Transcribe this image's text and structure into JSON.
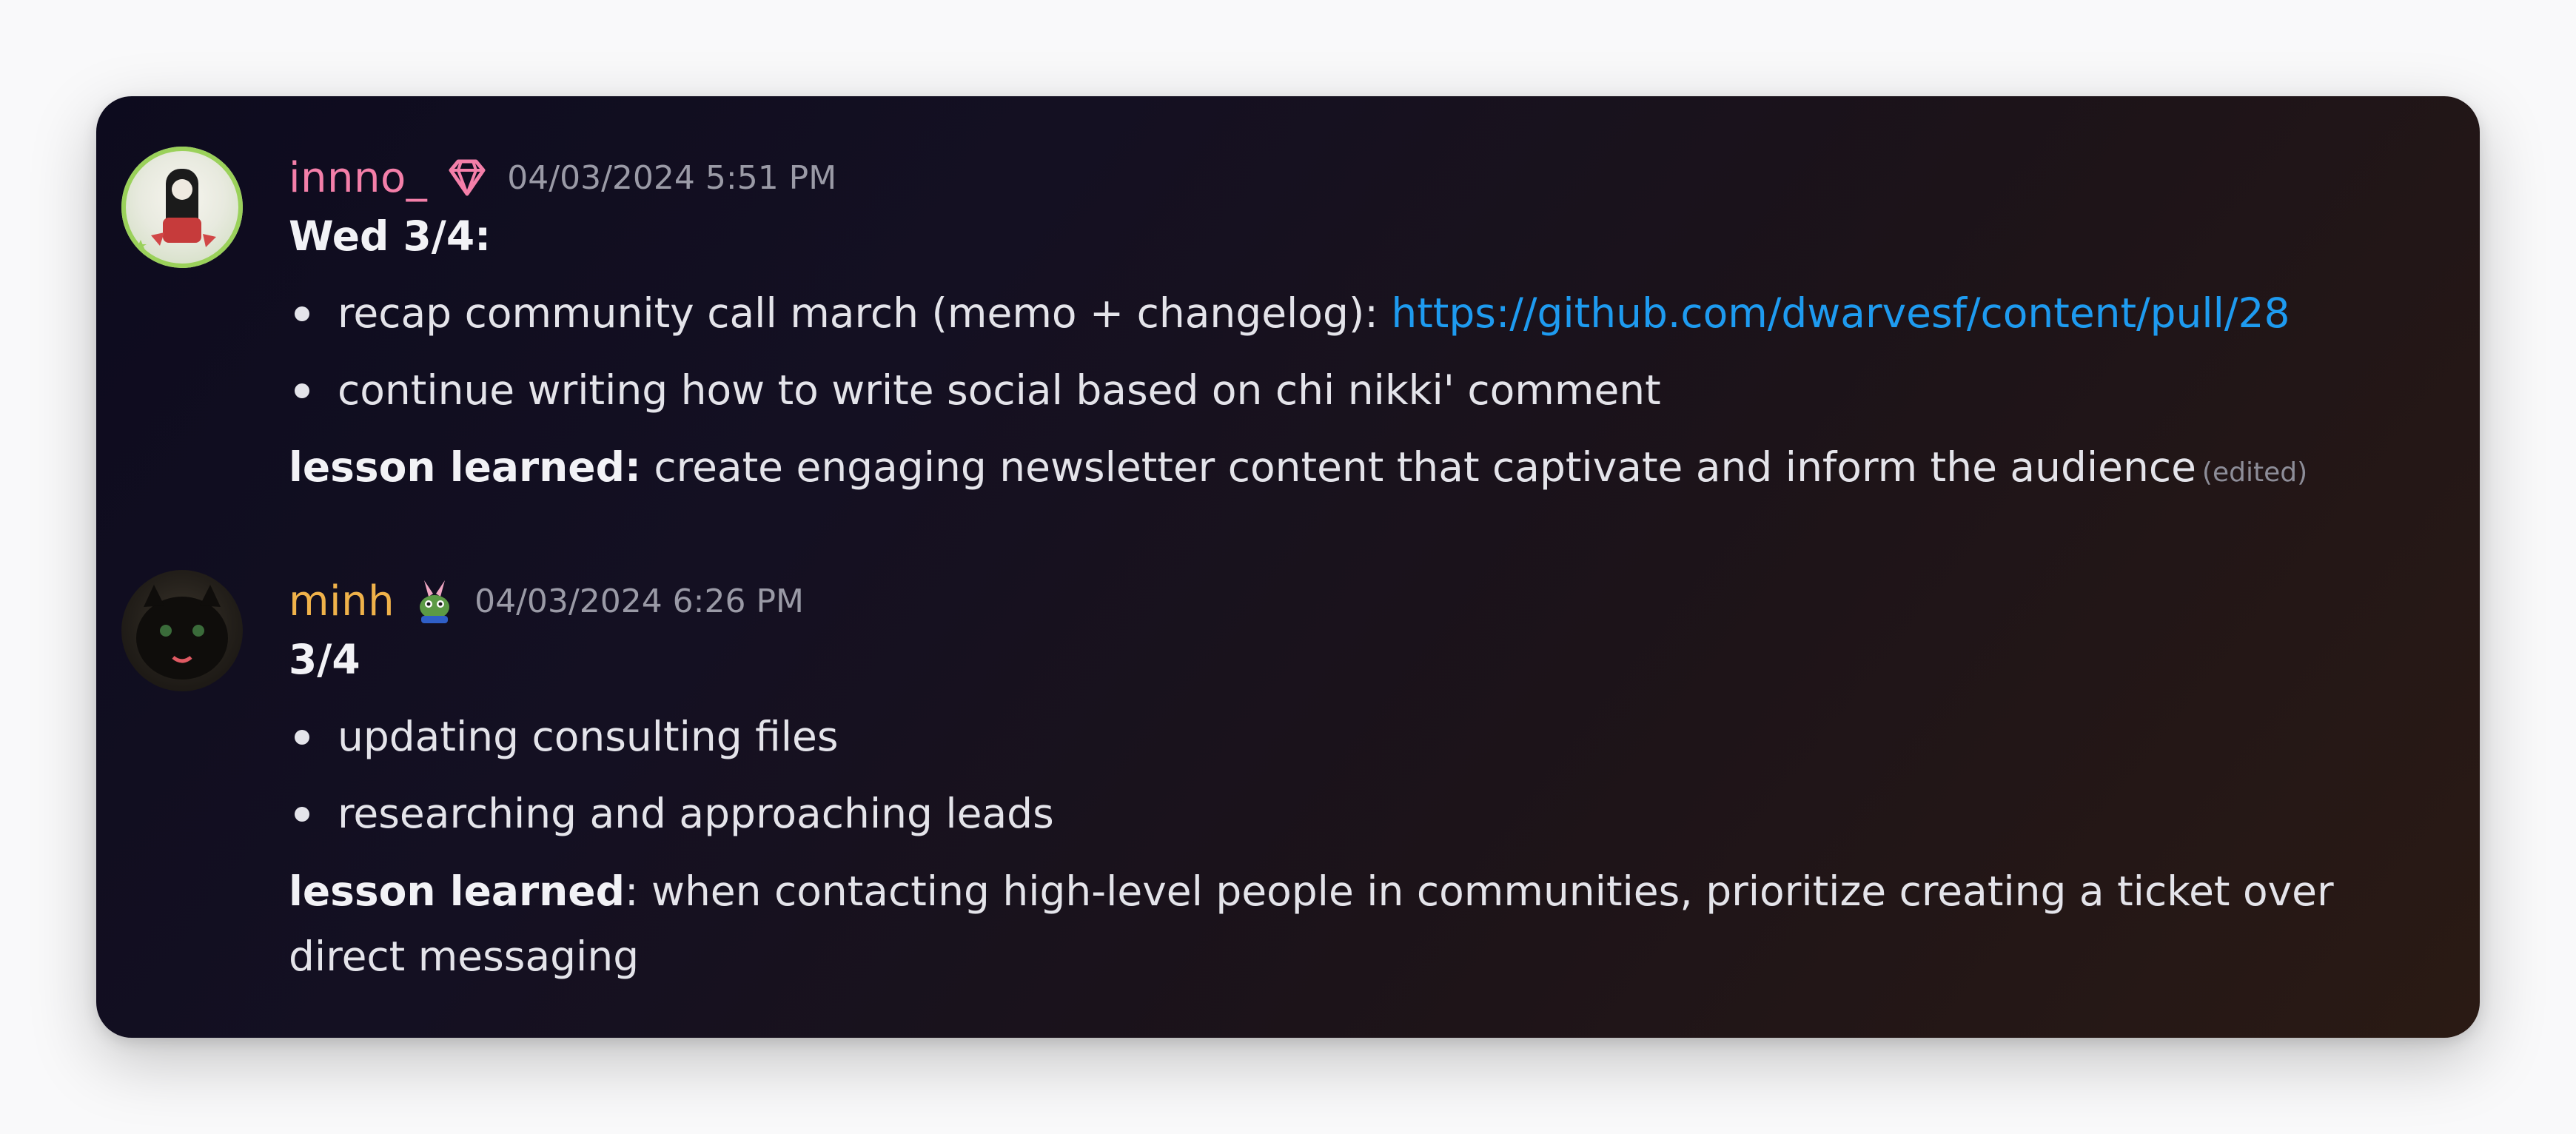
{
  "messages": [
    {
      "username": "innno_",
      "timestamp": "04/03/2024 5:51 PM",
      "heading": "Wed 3/4:",
      "bullets": [
        {
          "text": "recap community call march (memo + changelog): ",
          "link": "https://github.com/dwarvesf/content/pull/28"
        },
        {
          "text": "continue writing how to write social based on chi nikki' comment"
        }
      ],
      "lesson_label": "lesson learned:",
      "lesson_text": "  create engaging newsletter content that captivate and inform the audience",
      "edited_label": "(edited)",
      "badge_icon": "diamond-icon",
      "username_color": "#f47fa9"
    },
    {
      "username": "minh",
      "timestamp": "04/03/2024 6:26 PM",
      "heading": "3/4",
      "bullets": [
        {
          "text": "updating consulting files"
        },
        {
          "text": "researching and approaching leads"
        }
      ],
      "lesson_label": "lesson learned",
      "lesson_text": ": when contacting high-level people in communities, prioritize creating a ticket over direct messaging",
      "badge_icon": "frog-bunny-icon",
      "username_color": "#f0b24a"
    }
  ],
  "colors": {
    "link": "#1e9bf0",
    "text": "#e4e4ea",
    "timestamp": "#9a9aa6"
  }
}
